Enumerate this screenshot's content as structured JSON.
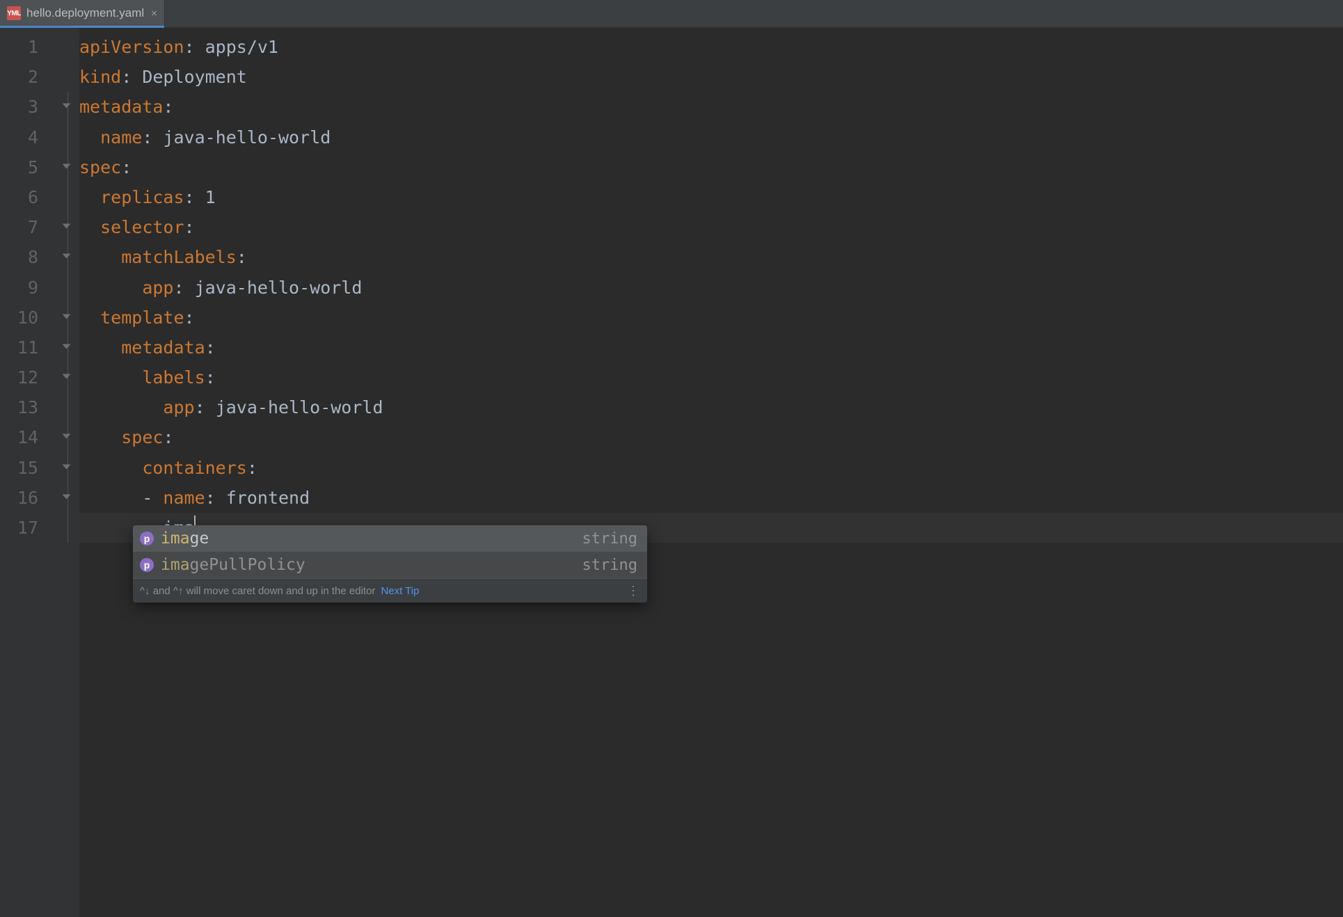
{
  "tab": {
    "filename": "hello.deployment.yaml",
    "icon_text": "YML"
  },
  "code": {
    "lines": [
      {
        "n": 1,
        "indent": "",
        "key": "apiVersion",
        "val": "apps/v1"
      },
      {
        "n": 2,
        "indent": "",
        "key": "kind",
        "val": "Deployment"
      },
      {
        "n": 3,
        "indent": "",
        "key": "metadata",
        "val": ""
      },
      {
        "n": 4,
        "indent": "  ",
        "key": "name",
        "val": "java-hello-world"
      },
      {
        "n": 5,
        "indent": "",
        "key": "spec",
        "val": ""
      },
      {
        "n": 6,
        "indent": "  ",
        "key": "replicas",
        "val": "1"
      },
      {
        "n": 7,
        "indent": "  ",
        "key": "selector",
        "val": ""
      },
      {
        "n": 8,
        "indent": "    ",
        "key": "matchLabels",
        "val": ""
      },
      {
        "n": 9,
        "indent": "      ",
        "key": "app",
        "val": "java-hello-world"
      },
      {
        "n": 10,
        "indent": "  ",
        "key": "template",
        "val": ""
      },
      {
        "n": 11,
        "indent": "    ",
        "key": "metadata",
        "val": ""
      },
      {
        "n": 12,
        "indent": "      ",
        "key": "labels",
        "val": ""
      },
      {
        "n": 13,
        "indent": "        ",
        "key": "app",
        "val": "java-hello-world"
      },
      {
        "n": 14,
        "indent": "    ",
        "key": "spec",
        "val": ""
      },
      {
        "n": 15,
        "indent": "      ",
        "key": "containers",
        "val": ""
      },
      {
        "n": 16,
        "indent": "      ",
        "dash": true,
        "key": "name",
        "val": "frontend"
      },
      {
        "n": 17,
        "indent": "        ",
        "partial": "ima"
      }
    ]
  },
  "autocomplete": {
    "items": [
      {
        "match": "ima",
        "rest": "ge",
        "type": "string"
      },
      {
        "match": "ima",
        "rest": "gePullPolicy",
        "type": "string"
      }
    ],
    "hint_prefix": "^↓ and ^↑ will move caret down and up in the editor",
    "hint_link": "Next Tip",
    "more": "⋮"
  }
}
